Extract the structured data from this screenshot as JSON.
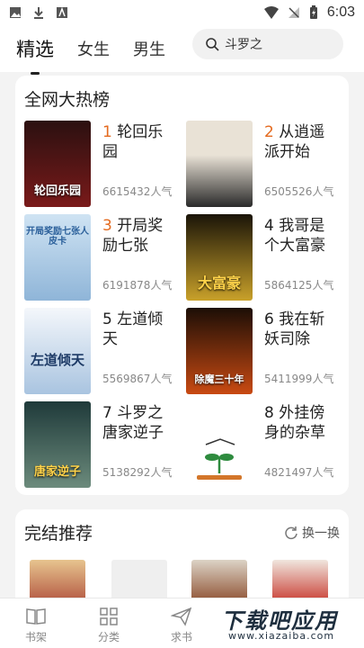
{
  "status_bar": {
    "time": "6:03"
  },
  "nav": {
    "tabs": [
      {
        "label": "精选",
        "active": true
      },
      {
        "label": "女生",
        "active": false
      },
      {
        "label": "男生",
        "active": false
      }
    ],
    "search_text": "斗罗之"
  },
  "hot_list": {
    "title": "全网大热榜",
    "books": [
      {
        "rank": "1",
        "title": "轮回乐园",
        "popularity": "6615432人气",
        "cover_text": "轮回乐园",
        "cover_colors": [
          "#2b1010",
          "#7a1a1a"
        ]
      },
      {
        "rank": "2",
        "title": "从逍遥派开始签…",
        "popularity": "6505526人气",
        "cover_text": "",
        "cover_colors": [
          "#e9e2d6",
          "#2a2a2a"
        ]
      },
      {
        "rank": "3",
        "title": "开局奖励七张人…",
        "popularity": "6191878人气",
        "cover_text": "开局奖励七张人皮卡",
        "cover_colors": [
          "#cfe3f3",
          "#8fb5d8"
        ]
      },
      {
        "rank": "4",
        "title": "我哥是个大富豪",
        "popularity": "5864125人气",
        "cover_text": "大富豪",
        "cover_colors": [
          "#1a1408",
          "#c9a12a"
        ]
      },
      {
        "rank": "5",
        "title": "左道倾天",
        "popularity": "5569867人气",
        "cover_text": "左道倾天",
        "cover_colors": [
          "#f4f7fb",
          "#a9c4e0"
        ]
      },
      {
        "rank": "6",
        "title": "我在斩妖司除魔…",
        "popularity": "5411999人气",
        "cover_text": "除魔三十年",
        "cover_colors": [
          "#1c0e06",
          "#c94a12"
        ]
      },
      {
        "rank": "7",
        "title": "斗罗之唐家逆子",
        "popularity": "5138292人气",
        "cover_text": "唐家逆子",
        "cover_colors": [
          "#1f3a3a",
          "#6c8b7c"
        ]
      },
      {
        "rank": "8",
        "title": "外挂傍身的杂草",
        "popularity": "4821497人气",
        "cover_text": "",
        "cover_colors": [
          "#ffffff",
          "#ffffff"
        ]
      }
    ]
  },
  "finish": {
    "title": "完结推荐",
    "refresh_label": "换一换"
  },
  "bottom_nav": {
    "items": [
      {
        "label": "书架",
        "icon": "book-icon"
      },
      {
        "label": "分类",
        "icon": "grid-icon"
      },
      {
        "label": "求书",
        "icon": "send-icon"
      }
    ]
  },
  "watermark": {
    "main": "下载吧应用",
    "sub": "www.xiazaiba.com"
  }
}
